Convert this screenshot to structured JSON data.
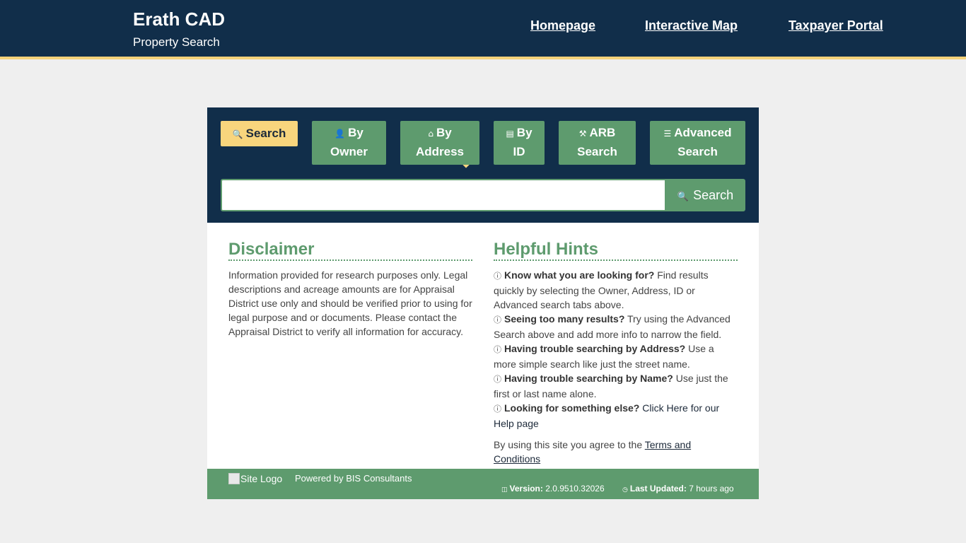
{
  "header": {
    "title": "Erath CAD",
    "subtitle": "Property Search",
    "nav": [
      "Homepage",
      "Interactive Map",
      "Taxpayer Portal"
    ]
  },
  "search": {
    "tabs": [
      {
        "icon": "search-icon",
        "line1": "Search",
        "line2": ""
      },
      {
        "icon": "user-icon",
        "line1": "By",
        "line2": "Owner"
      },
      {
        "icon": "home-icon",
        "line1": "By",
        "line2": "Address"
      },
      {
        "icon": "id-card-icon",
        "line1": "By",
        "line2": "ID"
      },
      {
        "icon": "gavel-icon",
        "line1": "ARB",
        "line2": "Search"
      },
      {
        "icon": "sliders-icon",
        "line1": "Advanced",
        "line2": "Search"
      }
    ],
    "input_value": "",
    "button_label": "Search"
  },
  "disclaimer": {
    "heading": "Disclaimer",
    "text": "Information provided for research purposes only. Legal descriptions and acreage amounts are for Appraisal District use only and should be verified prior to using for legal purpose and or documents. Please contact the Appraisal District to verify all information for accuracy."
  },
  "hints": {
    "heading": "Helpful Hints",
    "items": [
      {
        "bold": "Know what you are looking for?",
        "text": " Find results quickly by selecting the Owner, Address, ID or Advanced search tabs above."
      },
      {
        "bold": "Seeing too many results?",
        "text": " Try using the Advanced Search above and add more info to narrow the field."
      },
      {
        "bold": "Having trouble searching by Address?",
        "text": " Use a more simple search like just the street name."
      },
      {
        "bold": "Having trouble searching by Name?",
        "text": " Use just the first or last name alone."
      },
      {
        "bold": "Looking for something else?",
        "text": " Click Here for our Help page"
      }
    ],
    "terms_prefix": "By using this site you agree to the ",
    "terms_link": "Terms and Conditions"
  },
  "footer": {
    "logo_alt": "Site Logo",
    "powered_by": "Powered by BIS Consultants",
    "version_label": "Version:",
    "version_value": "2.0.9510.32026",
    "updated_label": "Last Updated:",
    "updated_value": "7 hours ago"
  },
  "colors": {
    "navy": "#112e4a",
    "green": "#5e9b6e",
    "gold": "#f8d57d",
    "background": "#efefef"
  }
}
